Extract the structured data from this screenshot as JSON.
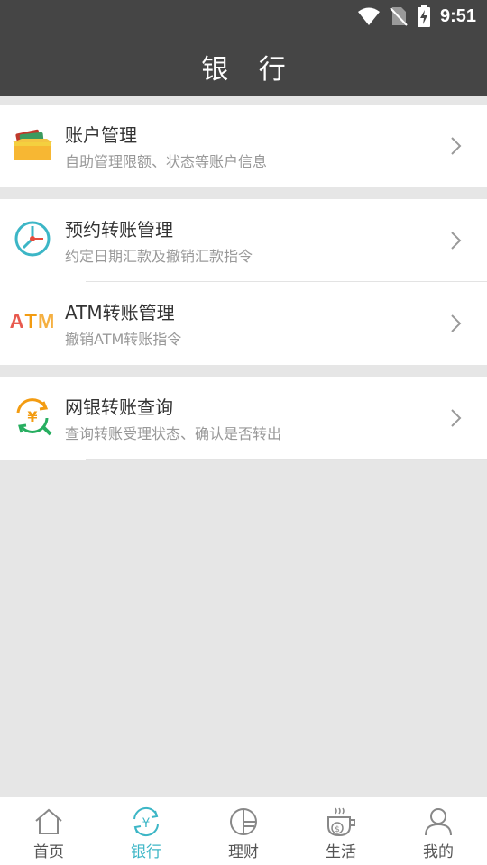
{
  "status": {
    "time": "9:51"
  },
  "header": {
    "title": "银 行"
  },
  "sections": [
    {
      "items": [
        {
          "title": "账户管理",
          "subtitle": "自助管理限额、状态等账户信息",
          "icon": "account-box-icon"
        }
      ]
    },
    {
      "items": [
        {
          "title": "预约转账管理",
          "subtitle": "约定日期汇款及撤销汇款指令",
          "icon": "clock-icon"
        },
        {
          "title": "ATM转账管理",
          "subtitle": "撤销ATM转账指令",
          "icon": "atm-icon",
          "icon_text": {
            "a": "A",
            "t": "T",
            "m": "M"
          }
        }
      ]
    },
    {
      "items": [
        {
          "title": "网银转账查询",
          "subtitle": "查询转账受理状态、确认是否转出",
          "icon": "yen-search-icon",
          "icon_text": "¥"
        }
      ]
    }
  ],
  "tabbar": {
    "active": "银行",
    "tabs": [
      {
        "label": "首页",
        "icon": "home-icon"
      },
      {
        "label": "银行",
        "icon": "yen-icon",
        "icon_text": "¥"
      },
      {
        "label": "理财",
        "icon": "pie-chart-icon"
      },
      {
        "label": "生活",
        "icon": "coffee-cup-icon",
        "icon_text": "$"
      },
      {
        "label": "我的",
        "icon": "user-icon"
      }
    ]
  },
  "colors": {
    "header_bg": "#454545",
    "accent": "#3cb6c6",
    "page_bg": "#e6e6e6"
  }
}
